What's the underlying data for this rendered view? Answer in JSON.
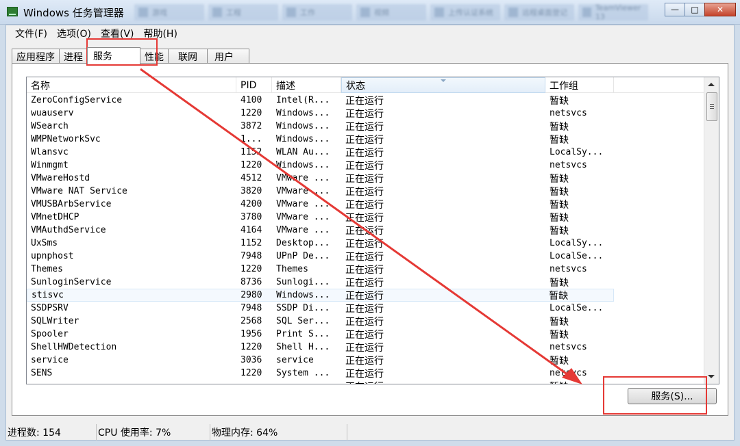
{
  "window": {
    "title": "Windows 任务管理器",
    "taskbar_blur": [
      "游戏",
      "工程",
      "工作",
      "视频",
      "上传认证系统",
      "远程桌面登记",
      "TeamViewer 13"
    ],
    "min_symbol": "—",
    "max_symbol": "□",
    "close_symbol": "✕"
  },
  "menu": [
    "文件(F)",
    "选项(O)",
    "查看(V)",
    "帮助(H)"
  ],
  "tabs": [
    "应用程序",
    "进程",
    "服务",
    "性能",
    "联网",
    "用户"
  ],
  "active_tab": "服务",
  "columns": [
    "名称",
    "PID",
    "描述",
    "状态",
    "工作组"
  ],
  "rows": [
    {
      "name": "ZeroConfigService",
      "pid": "4100",
      "desc": "Intel(R...",
      "status": "正在运行",
      "group": "暂缺"
    },
    {
      "name": "wuauserv",
      "pid": "1220",
      "desc": "Windows...",
      "status": "正在运行",
      "group": "netsvcs"
    },
    {
      "name": "WSearch",
      "pid": "3872",
      "desc": "Windows...",
      "status": "正在运行",
      "group": "暂缺"
    },
    {
      "name": "WMPNetworkSvc",
      "pid": "1...",
      "desc": "Windows...",
      "status": "正在运行",
      "group": "暂缺"
    },
    {
      "name": "Wlansvc",
      "pid": "1152",
      "desc": "WLAN Au...",
      "status": "正在运行",
      "group": "LocalSy..."
    },
    {
      "name": "Winmgmt",
      "pid": "1220",
      "desc": "Windows...",
      "status": "正在运行",
      "group": "netsvcs"
    },
    {
      "name": "VMwareHostd",
      "pid": "4512",
      "desc": "VMware ...",
      "status": "正在运行",
      "group": "暂缺"
    },
    {
      "name": "VMware NAT Service",
      "pid": "3820",
      "desc": "VMware ...",
      "status": "正在运行",
      "group": "暂缺"
    },
    {
      "name": "VMUSBArbService",
      "pid": "4200",
      "desc": "VMware ...",
      "status": "正在运行",
      "group": "暂缺"
    },
    {
      "name": "VMnetDHCP",
      "pid": "3780",
      "desc": "VMware ...",
      "status": "正在运行",
      "group": "暂缺"
    },
    {
      "name": "VMAuthdService",
      "pid": "4164",
      "desc": "VMware ...",
      "status": "正在运行",
      "group": "暂缺"
    },
    {
      "name": "UxSms",
      "pid": "1152",
      "desc": "Desktop...",
      "status": "正在运行",
      "group": "LocalSy..."
    },
    {
      "name": "upnphost",
      "pid": "7948",
      "desc": "UPnP De...",
      "status": "正在运行",
      "group": "LocalSe..."
    },
    {
      "name": "Themes",
      "pid": "1220",
      "desc": "Themes",
      "status": "正在运行",
      "group": "netsvcs"
    },
    {
      "name": "SunloginService",
      "pid": "8736",
      "desc": "Sunlogi...",
      "status": "正在运行",
      "group": "暂缺"
    },
    {
      "name": "stisvc",
      "pid": "2980",
      "desc": "Windows...",
      "status": "正在运行",
      "group": "暂缺"
    },
    {
      "name": "SSDPSRV",
      "pid": "7948",
      "desc": "SSDP Di...",
      "status": "正在运行",
      "group": "LocalSe..."
    },
    {
      "name": "SQLWriter",
      "pid": "2568",
      "desc": "SQL Ser...",
      "status": "正在运行",
      "group": "暂缺"
    },
    {
      "name": "Spooler",
      "pid": "1956",
      "desc": "Print S...",
      "status": "正在运行",
      "group": "暂缺"
    },
    {
      "name": "ShellHWDetection",
      "pid": "1220",
      "desc": "Shell H...",
      "status": "正在运行",
      "group": "netsvcs"
    },
    {
      "name": "service",
      "pid": "3036",
      "desc": "service",
      "status": "正在运行",
      "group": "暂缺"
    },
    {
      "name": "SENS",
      "pid": "1220",
      "desc": "System ...",
      "status": "正在运行",
      "group": "netsvcs"
    },
    {
      "name": "",
      "pid": "",
      "desc": "",
      "status": "正在运行",
      "group": "暂缺"
    }
  ],
  "selected_row": "stisvc",
  "services_button": "服务(S)...",
  "status": {
    "processes": "进程数: 154",
    "cpu": "CPU 使用率: 7%",
    "memory": "物理内存: 64%"
  },
  "colors": {
    "annotation": "#e53935",
    "selection": "#f4f9fe"
  }
}
